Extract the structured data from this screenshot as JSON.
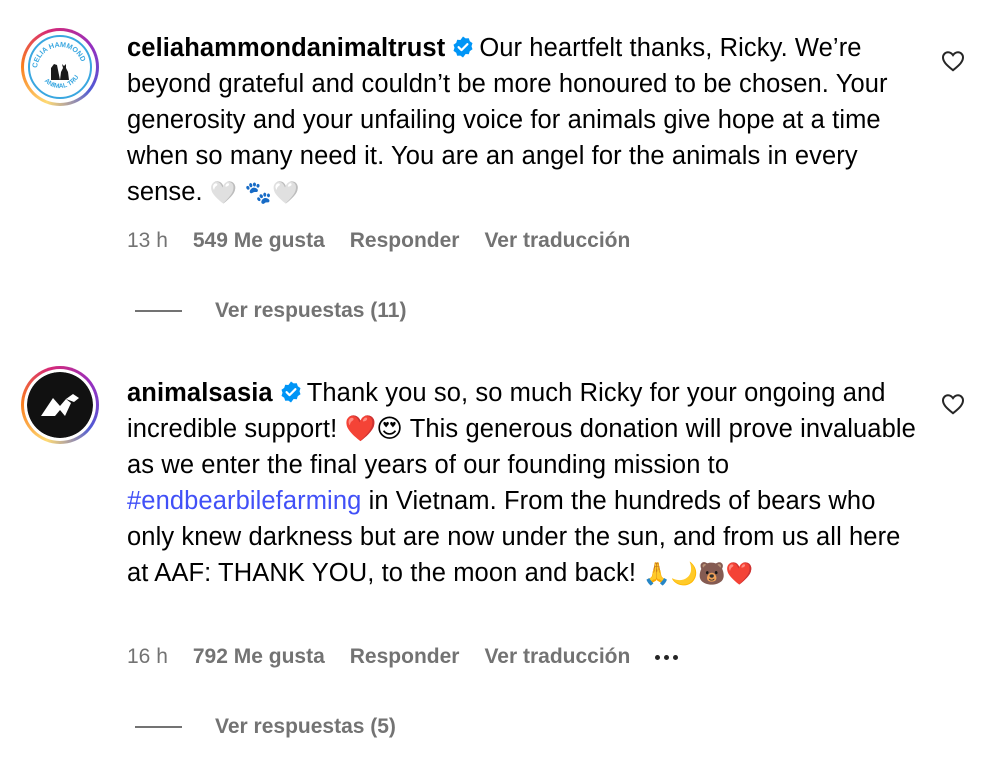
{
  "comments": [
    {
      "username": "celiahammondanimaltrust",
      "avatar_icon": "celia-hammond-logo-icon",
      "avatar_text": "CELIA HAMMOND ANIMAL TRUST",
      "verified_icon": "verified-badge-icon",
      "text": "Our heartfelt thanks, Ricky. We’re beyond grateful and couldn’t be more honoured to be chosen. Your generosity and your unfailing voice for animals give hope at a time when so many need it. You are an angel for the animals in every sense.",
      "emojis": "🤍 🐾🤍",
      "time": "13 h",
      "likes": "549 Me gusta",
      "reply_label": "Responder",
      "translate_label": "Ver traducción",
      "view_replies": "Ver respuestas (11)",
      "like_icon": "heart-outline-icon"
    },
    {
      "username": "animalsasia",
      "avatar_icon": "animals-asia-logo-icon",
      "verified_icon": "verified-badge-icon",
      "text_before_hashtag": "Thank you so, so much Ricky for your ongoing and incredible support! ❤️😍 This generous donation will prove invaluable as we enter the final years of our founding mission to ",
      "hashtag": "#endbearbilefarming",
      "text_after_hashtag": " in Vietnam. From the hundreds of bears who only knew darkness but are now under the sun, and from us all here at AAF: THANK YOU, to the moon and back!",
      "emojis": "🙏🌙🐻❤️",
      "time": "16 h",
      "likes": "792 Me gusta",
      "reply_label": "Responder",
      "translate_label": "Ver traducción",
      "more_icon": "more-options-icon",
      "view_replies": "Ver respuestas (5)",
      "like_icon": "heart-outline-icon"
    }
  ],
  "colors": {
    "text": "#000000",
    "secondary": "#737373",
    "hashtag": "#4150f7",
    "verified": "#0095f6",
    "celia_blue": "#3aa7e0",
    "animals_asia_black": "#111111"
  }
}
